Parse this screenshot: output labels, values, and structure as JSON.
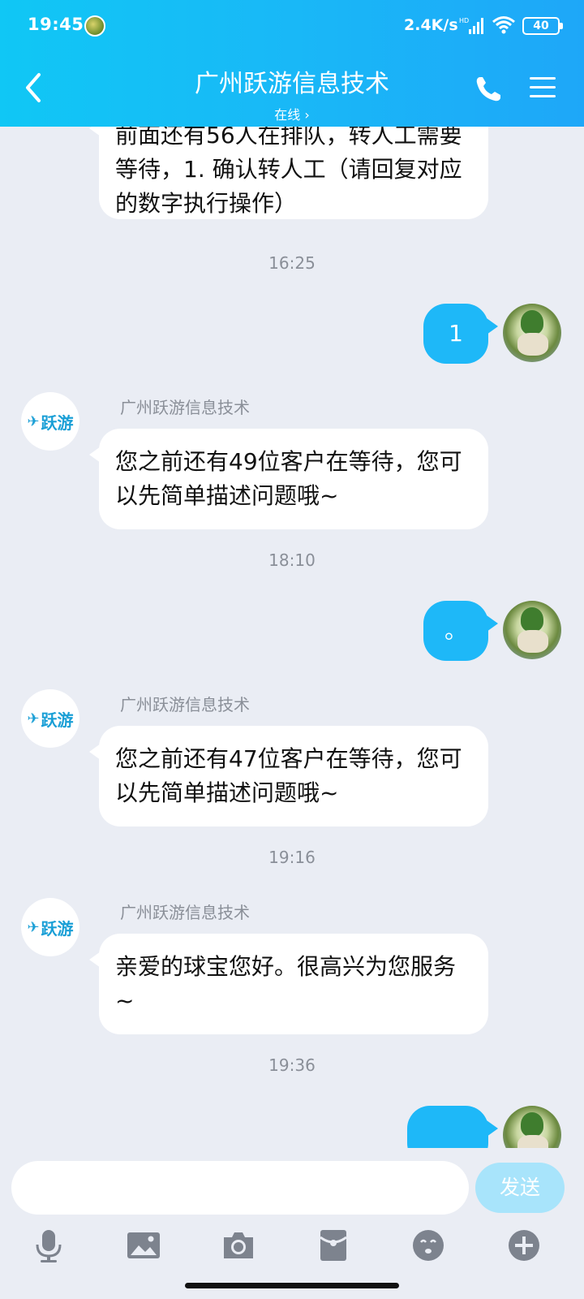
{
  "status_bar": {
    "time": "19:45",
    "speed": "2.4K/s",
    "signal_label": "HD",
    "battery": "40"
  },
  "header": {
    "title": "广州跃游信息技术",
    "status": "在线 ›"
  },
  "messages": {
    "m1_lines": "前面还有56人在排队，转人工需要等待，1. 确认转人工（请回复对应的数字执行操作）",
    "ts1": "16:25",
    "out1": "1",
    "sender": "广州跃游信息技术",
    "m2": "您之前还有49位客户在等待，您可以先简单描述问题哦~",
    "ts2": "18:10",
    "out2": "。",
    "m3": "您之前还有47位客户在等待，您可以先简单描述问题哦~",
    "ts3": "19:16",
    "m4": "亲爱的球宝您好。很高兴为您服务~",
    "ts4": "19:36",
    "out3": ""
  },
  "bot_logo_text": "跃游",
  "input": {
    "value": "",
    "placeholder": "",
    "send_label": "发送"
  },
  "toolbar": {
    "items": [
      "microphone-icon",
      "image-icon",
      "camera-icon",
      "red-packet-icon",
      "emoji-icon",
      "plus-icon"
    ]
  },
  "colors": {
    "header": "#19b8f7",
    "bubble_out": "#1eb8f8",
    "send_disabled": "#a8e4fb",
    "background": "#eaedf4"
  }
}
